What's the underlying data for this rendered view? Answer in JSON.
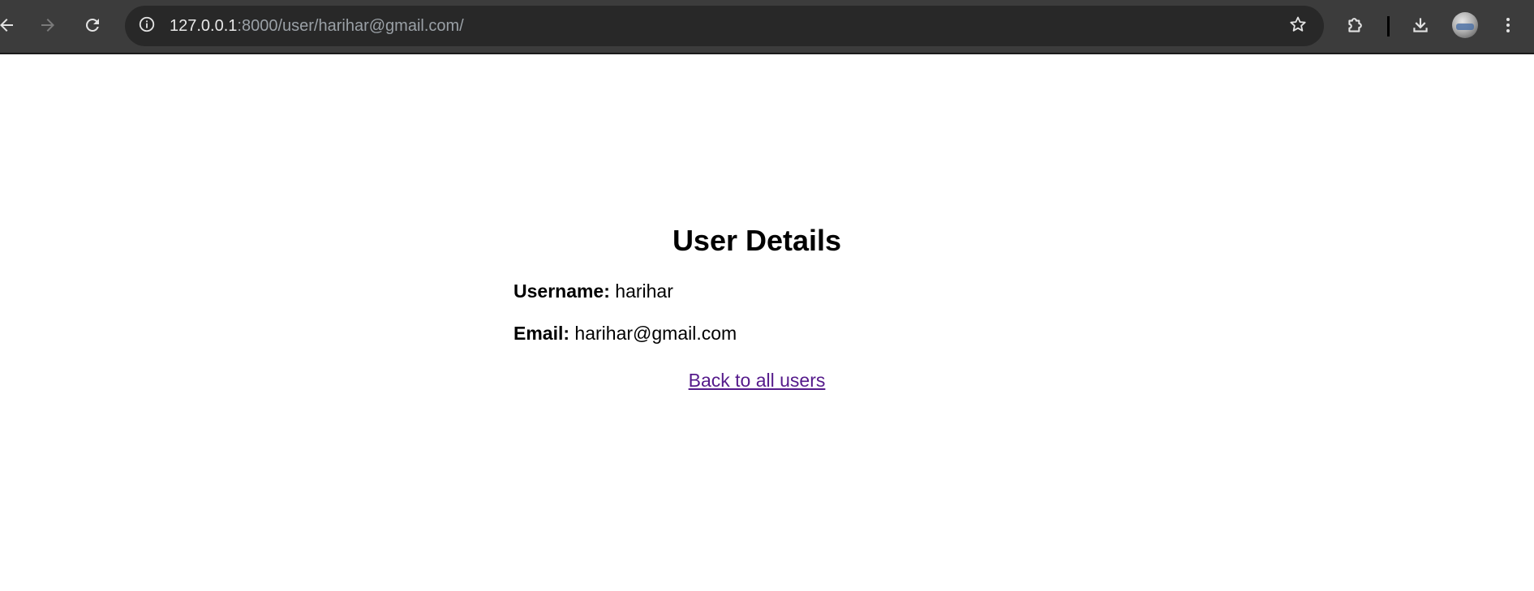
{
  "browser": {
    "url_host": "127.0.0.1",
    "url_rest": ":8000/user/harihar@gmail.com/",
    "icons": {
      "back": "back-arrow-icon",
      "forward": "forward-arrow-icon",
      "reload": "reload-icon",
      "site_info": "info-icon",
      "bookmark": "star-icon",
      "extensions": "puzzle-icon",
      "downloads": "download-icon",
      "profile": "avatar",
      "menu": "kebab-menu-icon"
    },
    "colors": {
      "toolbar": "#3c3c3c",
      "omnibox": "#282828",
      "url_host": "#e8e8e8",
      "url_rest": "#9aa0a6",
      "icon": "#e3e3e3",
      "icon_disabled": "#7a7a7a"
    }
  },
  "page": {
    "title": "User Details",
    "username_label": "Username:",
    "username_value": "harihar",
    "email_label": "Email:",
    "email_value": "harihar@gmail.com",
    "back_link": "Back to all users",
    "colors": {
      "text": "#000000",
      "visited_link": "#551a8b",
      "background": "#ffffff"
    }
  }
}
